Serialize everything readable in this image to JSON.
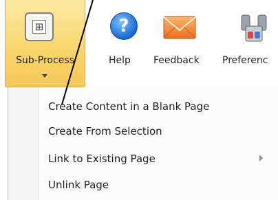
{
  "ribbon": {
    "sub_process_label": "Sub-Process",
    "help_label": "Help",
    "feedback_label": "Feedback",
    "preferences_label": "Preferenc"
  },
  "menu": {
    "items": [
      {
        "label": "Create Content in a Blank Page"
      },
      {
        "label": "Create From Selection"
      },
      {
        "label": "Link to Existing Page"
      },
      {
        "label": "Unlink Page"
      }
    ]
  },
  "colors": {
    "active_button_fill": "#f9d46a",
    "active_button_border": "#d9a93f",
    "menu_background": "#fbfbfb",
    "help_icon": "#1f6fd6",
    "feedback_icon": "#f08a3c"
  },
  "icons": [
    "sub-process-icon",
    "help-icon",
    "feedback-envelope-icon",
    "preferences-icon",
    "chevron-down-icon",
    "chevron-right-icon"
  ]
}
